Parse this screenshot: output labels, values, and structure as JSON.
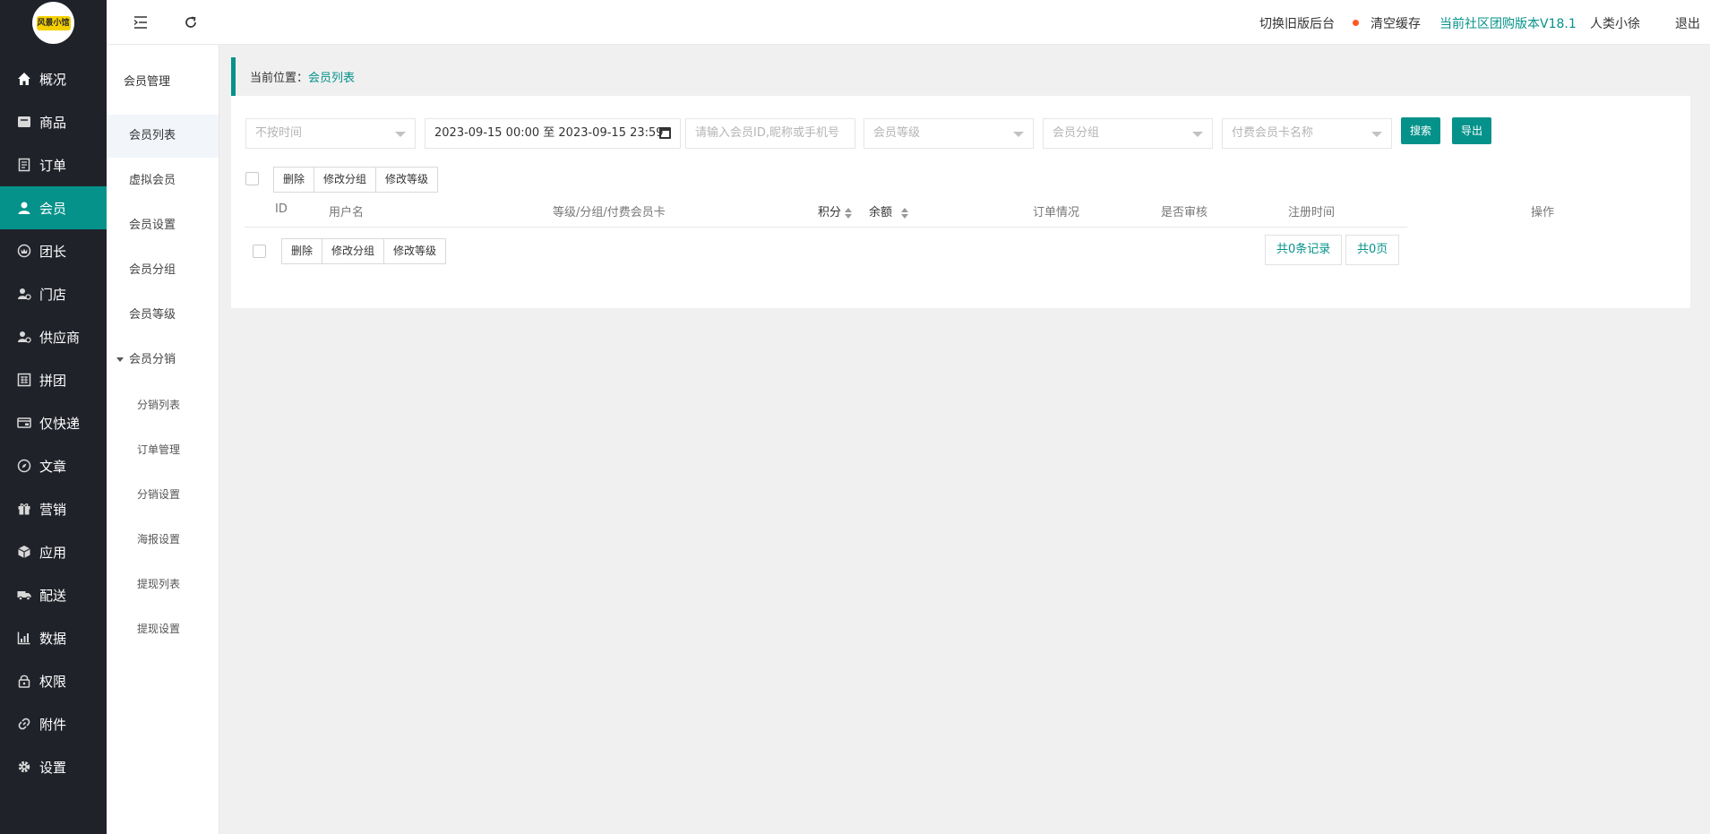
{
  "logo_text": "风景小馆",
  "nav": [
    {
      "label": "概况",
      "icon": "home-icon"
    },
    {
      "label": "商品",
      "icon": "goods-icon"
    },
    {
      "label": "订单",
      "icon": "order-icon"
    },
    {
      "label": "会员",
      "icon": "user-icon"
    },
    {
      "label": "团长",
      "icon": "leader-icon"
    },
    {
      "label": "门店",
      "icon": "store-icon"
    },
    {
      "label": "供应商",
      "icon": "supplier-icon"
    },
    {
      "label": "拼团",
      "icon": "group-buy-icon"
    },
    {
      "label": "仅快递",
      "icon": "express-icon"
    },
    {
      "label": "文章",
      "icon": "compass-icon"
    },
    {
      "label": "营销",
      "icon": "gift-icon"
    },
    {
      "label": "应用",
      "icon": "cube-icon"
    },
    {
      "label": "配送",
      "icon": "truck-icon"
    },
    {
      "label": "数据",
      "icon": "chart-icon"
    },
    {
      "label": "权限",
      "icon": "lock-icon"
    },
    {
      "label": "附件",
      "icon": "link-icon"
    },
    {
      "label": "设置",
      "icon": "gear-icon"
    }
  ],
  "subnav": {
    "title": "会员管理",
    "items": [
      "会员列表",
      "虚拟会员",
      "会员设置",
      "会员分组",
      "会员等级"
    ],
    "group": "会员分销",
    "children": [
      "分销列表",
      "订单管理",
      "分销设置",
      "海报设置",
      "提现列表",
      "提现设置"
    ]
  },
  "topbar": {
    "switch_old": "切换旧版后台",
    "clear_cache": "清空缓存",
    "version": "当前社区团购版本V18.1",
    "user": "人类小徐",
    "logout": "退出"
  },
  "breadcrumb": {
    "prefix": "当前位置：",
    "current": "会员列表"
  },
  "filters": {
    "time_select": "不按时间",
    "date_range": "2023-09-15 00:00 至 2023-09-15 23:59",
    "keyword_placeholder": "请输入会员ID,昵称或手机号",
    "level_select": "会员等级",
    "group_select": "会员分组",
    "card_select": "付费会员卡名称",
    "search_label": "搜索",
    "export_label": "导出"
  },
  "batch": {
    "delete": "删除",
    "edit_group": "修改分组",
    "edit_level": "修改等级"
  },
  "table": {
    "columns": {
      "id": "ID",
      "username": "用户名",
      "level": "等级/分组/付费会员卡",
      "points": "积分",
      "balance": "余额",
      "orders": "订单情况",
      "audit": "是否审核",
      "register_time": "注册时间",
      "actions": "操作"
    },
    "rows": []
  },
  "pagination": {
    "total_records": "共0条记录",
    "total_pages": "共0页"
  },
  "colors": {
    "accent": "#05928a",
    "nav_bg": "#20222a",
    "status_dot": "#ff5722"
  }
}
